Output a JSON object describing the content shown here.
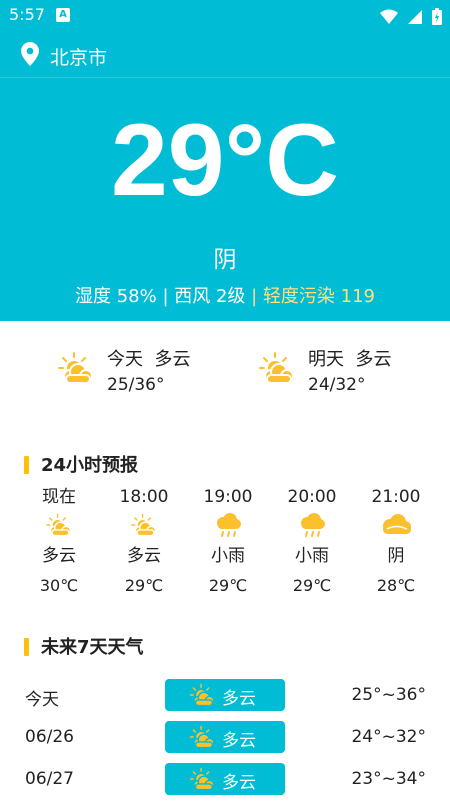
{
  "status_bar": {
    "time": "5:57",
    "notif_letter": "A"
  },
  "location": {
    "city": "北京市"
  },
  "current": {
    "temperature": "29°C",
    "condition": "阴",
    "humidity": "湿度 58%",
    "wind": "| 西风 2级",
    "aqi": "| 轻度污染 119"
  },
  "overview": [
    {
      "day": "今天",
      "condition": "多云",
      "range": "25/36°",
      "icon": "cloud-sun-icon"
    },
    {
      "day": "明天",
      "condition": "多云",
      "range": "24/32°",
      "icon": "cloud-sun-icon"
    }
  ],
  "hourly_title": "24小时预报",
  "hourly": [
    {
      "time": "现在",
      "condition": "多云",
      "temp": "30℃",
      "icon": "cloud-sun-icon"
    },
    {
      "time": "18:00",
      "condition": "多云",
      "temp": "29℃",
      "icon": "cloud-sun-icon"
    },
    {
      "time": "19:00",
      "condition": "小雨",
      "temp": "29℃",
      "icon": "rain-icon"
    },
    {
      "time": "20:00",
      "condition": "小雨",
      "temp": "29℃",
      "icon": "rain-icon"
    },
    {
      "time": "21:00",
      "condition": "阴",
      "temp": "28℃",
      "icon": "overcast-icon"
    }
  ],
  "daily_title": "未来7天天气",
  "daily": [
    {
      "date": "今天",
      "condition": "多云",
      "range": "25°~36°"
    },
    {
      "date": "06/26",
      "condition": "多云",
      "range": "24°~32°"
    },
    {
      "date": "06/27",
      "condition": "多云",
      "range": "23°~34°"
    }
  ],
  "colors": {
    "primary": "#00bcd4",
    "accent": "#ffc107",
    "aqi_text": "#ffe082",
    "icon_yellow": "#fbc02d"
  }
}
